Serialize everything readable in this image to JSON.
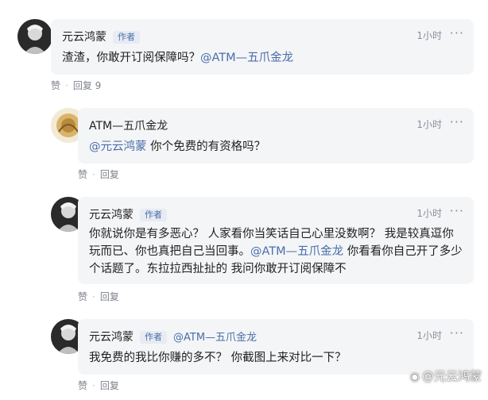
{
  "comments": [
    {
      "name": "元云鸿蒙",
      "tag": "作者",
      "time": "1小时",
      "more": "···",
      "text_plain": "渣渣，你敢开订阅保障吗？",
      "text_mention": "@ATM—五爪金龙",
      "like": "赞",
      "reply": "回复 9"
    },
    {
      "name": "ATM—五爪金龙",
      "time": "1小时",
      "more": "···",
      "text_mention": "@元云鸿蒙",
      "text_plain": " 你个免费的有资格吗？",
      "like": "赞",
      "reply": "回复"
    },
    {
      "name": "元云鸿蒙",
      "tag": "作者",
      "time": "1小时",
      "more": "···",
      "text_part1": "你就说你是有多恶心？ 人家看你当笑话自己心里没数啊？ 我是较真逗你玩而已、你也真把自己当回事。",
      "text_mention": "@ATM—五爪金龙",
      "text_part2": " 你看看你自己开了多少个话题了。东拉拉西扯扯的 我问你敢开订阅保障不",
      "like": "赞",
      "reply": "回复"
    },
    {
      "name": "元云鸿蒙",
      "tag": "作者",
      "mention_inline": "@ATM—五爪金龙",
      "time": "1小时",
      "more": "···",
      "text_plain": "我免费的我比你赚的多不？ 你截图上来对比一下？",
      "like": "赞",
      "reply": "回复"
    }
  ],
  "watermark": {
    "icon": "weibo-icon",
    "text": "@元云鸿蒙"
  },
  "colors": {
    "bubble": "#f4f5f7",
    "mention": "#4a6ea9",
    "tag_bg": "#e7ebf3"
  }
}
